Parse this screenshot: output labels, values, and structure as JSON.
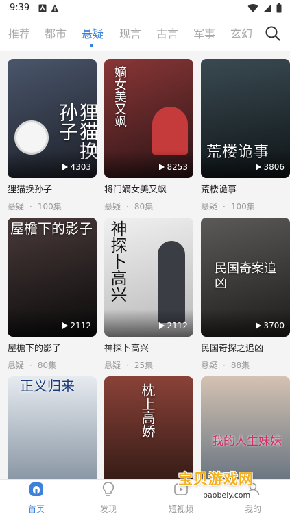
{
  "status": {
    "time": "9:39"
  },
  "tabs": [
    {
      "label": "推荐",
      "active": false
    },
    {
      "label": "都市",
      "active": false
    },
    {
      "label": "悬疑",
      "active": true
    },
    {
      "label": "现言",
      "active": false
    },
    {
      "label": "古言",
      "active": false
    },
    {
      "label": "军事",
      "active": false
    },
    {
      "label": "玄幻",
      "active": false
    }
  ],
  "dramas": [
    {
      "title": "狸猫换孙子",
      "genre": "悬疑",
      "episodes": "100集",
      "views": "4303",
      "poster_text": "狸猫换孙子",
      "colors": [
        "#3a4456",
        "#1c1f28"
      ]
    },
    {
      "title": "将门嫡女美又飒",
      "genre": "悬疑",
      "episodes": "80集",
      "views": "8253",
      "poster_text": "嫡女美又飒",
      "colors": [
        "#6a2a2a",
        "#2b1416"
      ]
    },
    {
      "title": "荒楼诡事",
      "genre": "悬疑",
      "episodes": "100集",
      "views": "3806",
      "poster_text": "荒楼诡事",
      "colors": [
        "#2a3a40",
        "#0e1416"
      ]
    },
    {
      "title": "屋檐下的影子",
      "genre": "悬疑",
      "episodes": "80集",
      "views": "2112",
      "poster_text": "屋檐下的影子",
      "colors": [
        "#3a3030",
        "#111"
      ]
    },
    {
      "title": "神探卜高兴",
      "genre": "悬疑",
      "episodes": "25集",
      "views": "2112",
      "poster_text": "神探卜高兴",
      "colors": [
        "#e8e8e8",
        "#bdbdbd"
      ]
    },
    {
      "title": "民国奇探之追凶",
      "genre": "悬疑",
      "episodes": "88集",
      "views": "3700",
      "poster_text": "民国奇案追凶",
      "colors": [
        "#4c4a48",
        "#1e1c1a"
      ]
    },
    {
      "title": "",
      "genre": "",
      "episodes": "",
      "views": "",
      "poster_text": "正义归来",
      "colors": [
        "#dfe4ea",
        "#8896a6"
      ]
    },
    {
      "title": "",
      "genre": "",
      "episodes": "",
      "views": "",
      "poster_text": "枕上高娇",
      "colors": [
        "#7a3a32",
        "#2a1612"
      ]
    },
    {
      "title": "",
      "genre": "",
      "episodes": "",
      "views": "",
      "poster_text": "我的人生妹妹",
      "colors": [
        "#c9b7a8",
        "#5a6a7a"
      ]
    }
  ],
  "nav": [
    {
      "label": "首页",
      "icon": "home-icon",
      "active": true
    },
    {
      "label": "发现",
      "icon": "lightbulb-icon",
      "active": false
    },
    {
      "label": "短视频",
      "icon": "video-icon",
      "active": false
    },
    {
      "label": "我的",
      "icon": "profile-icon",
      "active": false
    }
  ],
  "watermark": {
    "text": "宝贝游戏网",
    "url": "baobeiy.com"
  },
  "accent": "#3c82d8"
}
